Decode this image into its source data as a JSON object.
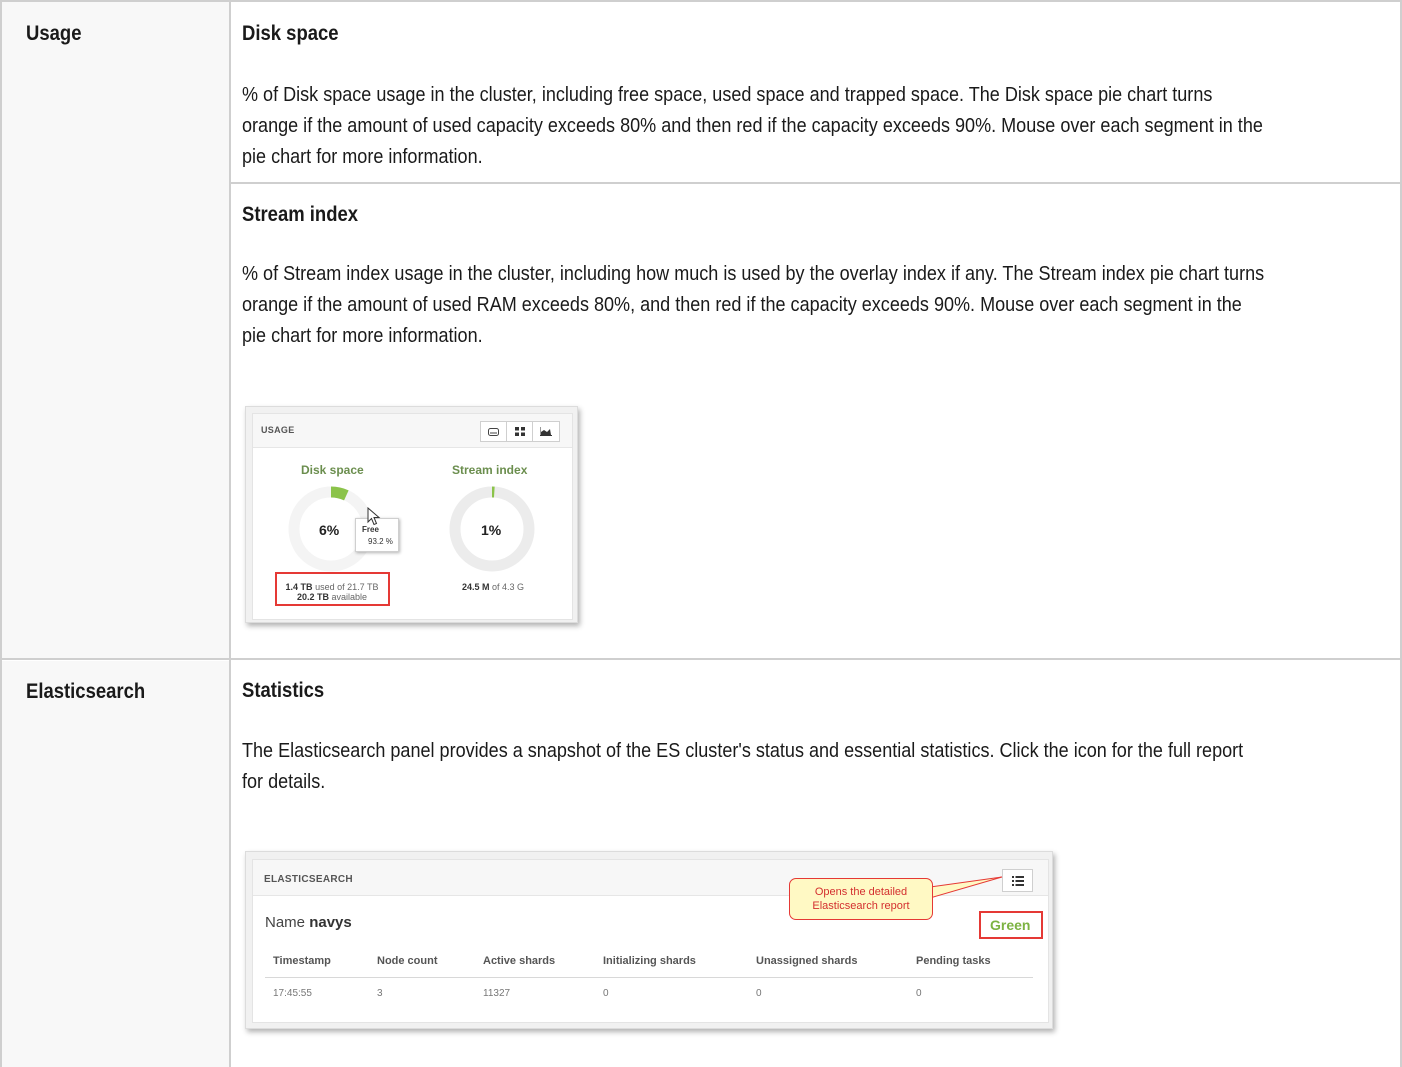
{
  "rows": [
    {
      "label": "Usage",
      "sections": [
        {
          "title": "Disk space",
          "body": "% of Disk space usage in the cluster, including free space, used space and trapped space. The Disk space pie chart turns orange if the amount of used capacity exceeds 80% and then red if the capacity exceeds 90%. Mouse over each segment in the pie chart for more information."
        },
        {
          "title": "Stream index",
          "body": "% of Stream index usage in the cluster, including how much is used by the overlay index if any. The Stream index pie chart turns orange if the amount of used RAM exceeds 80%, and then red if the capacity exceeds 90%. Mouse over each segment in the pie chart for more information."
        }
      ],
      "widget": {
        "title": "USAGE",
        "buttons": [
          "disk-icon",
          "grid-icon",
          "area-chart-icon"
        ],
        "disk": {
          "title": "Disk space",
          "percent_label": "6%",
          "used_fraction": 0.068,
          "tooltip_label": "Free",
          "tooltip_value": "93.2 %",
          "used_value": "1.4 TB",
          "used_of": "used of 21.7 TB",
          "available_value": "20.2 TB",
          "available_label": "available"
        },
        "stream": {
          "title": "Stream index",
          "percent_label": "1%",
          "used_fraction": 0.01,
          "used_value": "24.5 M",
          "of_label": "of 4.3 G"
        },
        "colors": {
          "used": "#8bc34a",
          "free": "#eeeeee",
          "title": "#6b8e4e",
          "highlight": "#e53935"
        }
      }
    },
    {
      "label": "Elasticsearch",
      "sections": [
        {
          "title": "Statistics",
          "body": "The Elasticsearch panel provides a snapshot of the ES cluster's status and essential statistics. Click the icon for the full report for details."
        }
      ],
      "widget": {
        "title": "ELASTICSEARCH",
        "name_label": "Name",
        "name_value": "navys",
        "status": "Green",
        "callout": "Opens the detailed Elasticsearch report",
        "report_button_icon": "list-icon",
        "columns": [
          "Timestamp",
          "Node count",
          "Active shards",
          "Initializing shards",
          "Unassigned shards",
          "Pending tasks"
        ],
        "values": [
          "17:45:55",
          "3",
          "11327",
          "0",
          "0",
          "0"
        ]
      }
    }
  ]
}
